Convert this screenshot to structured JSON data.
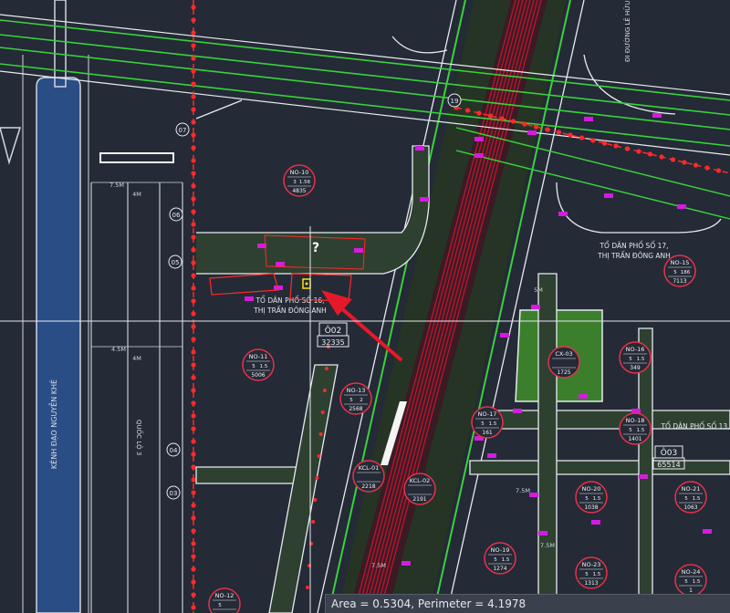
{
  "canvas": {
    "vertical_road_label": "QUỐC LỘ 3",
    "canal_label": "KÊNH ĐẠO NGUYỄN KHÊ",
    "top_road_label": "ĐI ĐƯỜNG LÊ HỮU TỰ"
  },
  "zones": [
    {
      "text_lines": [
        "TỔ DÂN PHỐ SỐ 17,",
        "THỊ TRẤN ĐÔNG ANH"
      ]
    },
    {
      "text_lines": [
        "TỔ DÂN PHỐ SỐ 16,",
        "THỊ TRẤN ĐÔNG ANH"
      ]
    },
    {
      "text_lines": [
        "TỔ DÂN PHỐ SỐ 13,"
      ]
    }
  ],
  "parcels": [
    {
      "code": "NO-10",
      "v1": "3",
      "v2": "1.56",
      "area": "4835"
    },
    {
      "code": "NO-15",
      "v1": "5",
      "v2": "186",
      "area": "7113"
    },
    {
      "code": "NO-11",
      "v1": "5",
      "v2": "1.5",
      "area": "5006"
    },
    {
      "code": "NO-13",
      "v1": "5",
      "v2": "2",
      "area": "2568"
    },
    {
      "code": "CX-03",
      "v1": "",
      "v2": "",
      "area": "1725"
    },
    {
      "code": "NO-16",
      "v1": "5",
      "v2": "1.5",
      "area": "349"
    },
    {
      "code": "NO-17",
      "v1": "5",
      "v2": "1.5",
      "area": "161"
    },
    {
      "code": "NO-18",
      "v1": "5",
      "v2": "1.5",
      "area": "1401"
    },
    {
      "code": "KCL-01",
      "v1": "",
      "v2": "",
      "area": "2218"
    },
    {
      "code": "KCL-02",
      "v1": "",
      "v2": "",
      "area": "2191"
    },
    {
      "code": "NO-19",
      "v1": "5",
      "v2": "1.5",
      "area": "1274"
    },
    {
      "code": "NO-20",
      "v1": "5",
      "v2": "1.5",
      "area": "1038"
    },
    {
      "code": "NO-21",
      "v1": "5",
      "v2": "1.5",
      "area": "1063"
    },
    {
      "code": "NO-23",
      "v1": "5",
      "v2": "1.5",
      "area": "1313"
    },
    {
      "code": "NO-24",
      "v1": "5",
      "v2": "1.5",
      "area": "1"
    },
    {
      "code": "NO-12",
      "v1": "5",
      "v2": "",
      "area": ""
    }
  ],
  "cells": [
    {
      "code": "Ô02",
      "area": "32335"
    },
    {
      "code": "Ô03",
      "area": "65514"
    }
  ],
  "node_markers": [
    "07",
    "06",
    "05",
    "04",
    "03",
    "19"
  ],
  "dimensions": [
    "4M",
    "4M",
    "7.5M",
    "4.5M",
    "5M",
    "7.5M",
    "7.5M",
    "7.5M"
  ],
  "question_mark": "?",
  "status": {
    "text": "Area = 0.5304, Perimeter = 4.1978"
  },
  "colors": {
    "background": "#242a36",
    "road_outline": "#e8ecf0",
    "road_fill": "#2e4030",
    "green_line": "#39d23c",
    "median": "#c0142e",
    "canal": "#2a4d86",
    "red_marker": "#ff2a2a",
    "parcel_circle": "#e8324a",
    "park": "#3b7f2d",
    "magenta": "#d51be0",
    "arrow": "#e6192a",
    "highlight": "#ffe400"
  }
}
